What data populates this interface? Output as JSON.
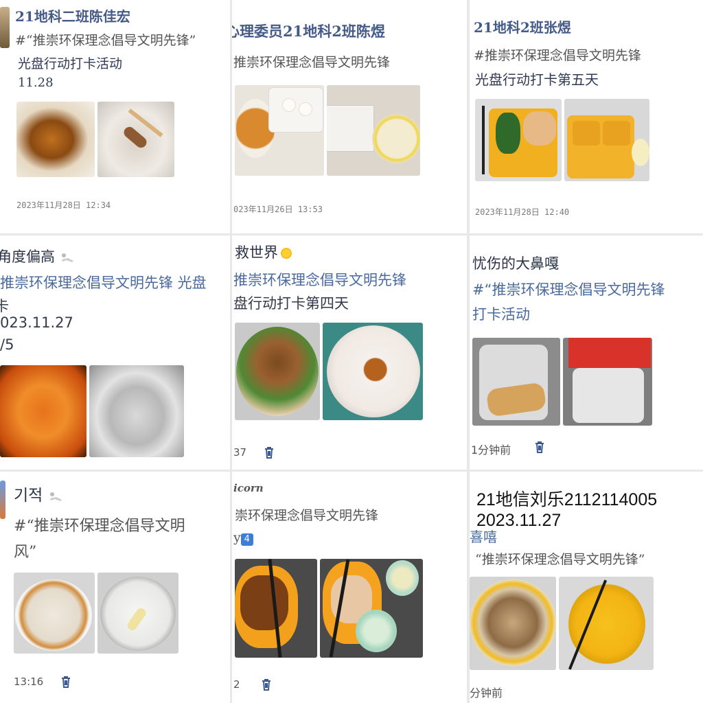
{
  "panels": {
    "p1": {
      "title": "21地科二班陈佳宏",
      "hashtag": "#“推崇环保理念倡导文明先锋”",
      "activity": "光盘行动打卡活动",
      "date": "11.28",
      "stamp": "2023年11月28日 12:34"
    },
    "p2": {
      "title": "心理委员21地科2班陈煜",
      "hashtag": "推崇环保理念倡导文明先锋",
      "stamp": "023年11月26日 13:53"
    },
    "p3": {
      "title": "21地科2班张煜",
      "hashtag": "#推崇环保理念倡导文明先锋",
      "activity": "光盘行动打卡第五天",
      "stamp": "2023年11月28日 12:40"
    },
    "p4": {
      "name": "角度偏高",
      "hashtag": "推崇环保理念倡导文明先锋 光盘",
      "line2": "卡",
      "date": "023.11.27",
      "frac": "/5"
    },
    "p5": {
      "name": "救世界",
      "hashtag": "推崇环保理念倡导文明先锋",
      "activity": "盘行动打卡第四天",
      "time": "37"
    },
    "p6": {
      "name": "忧伤的大鼻嘎",
      "hashtag": "#“推崇环保理念倡导文明先锋",
      "activity": "打卡活动",
      "time": "1分钟前"
    },
    "p7": {
      "name": "기적",
      "hashtag": "#“推崇环保理念倡导文明",
      "tail": "风”",
      "time": "13:16"
    },
    "p8": {
      "name": "icorn",
      "hashtag": "崇环保理念倡导文明先锋",
      "line3": "y",
      "badge": "4",
      "time": "2"
    },
    "p9": {
      "name_line": "21地信刘乐2112114005",
      "date": "2023.11.27",
      "name2": "喜嘻",
      "hashtag": "“推崇环保理念倡导文明先锋”",
      "time": "分钟前"
    }
  },
  "icons": {
    "trash": "trash-icon",
    "sun": "sun-emoji-icon",
    "figure": "reclining-person-icon",
    "keycap": "keycap-four-icon"
  },
  "colors": {
    "handwritten_title": "#445a88",
    "hashtag_blue": "#4a6a9e",
    "timestamp_gray": "#7a7a7a"
  }
}
